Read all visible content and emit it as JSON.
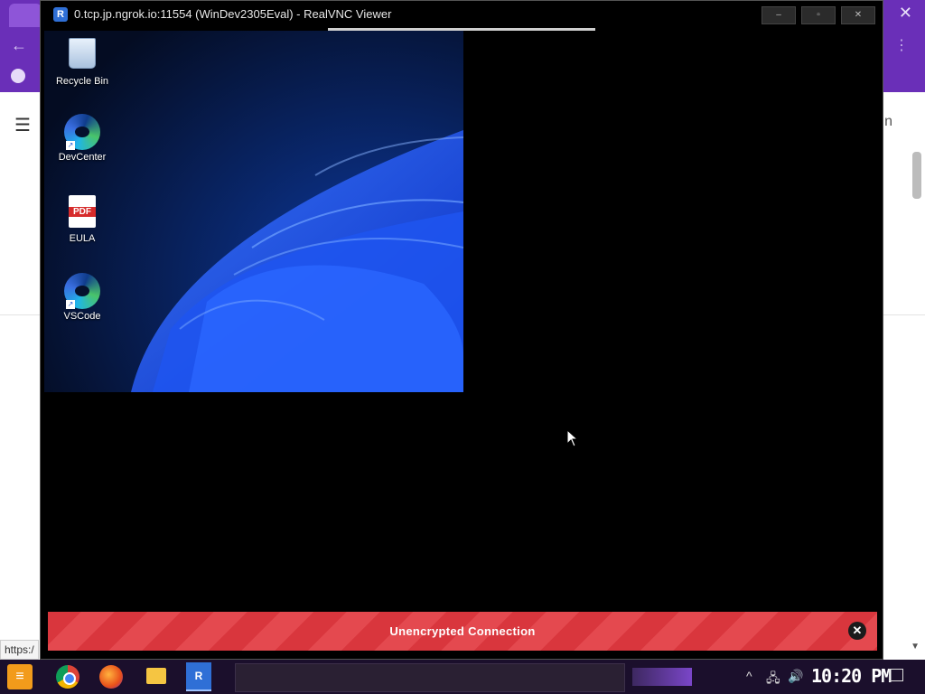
{
  "background": {
    "status_url": "https:/"
  },
  "vnc": {
    "title": "0.tcp.jp.ngrok.io:11554 (WinDev2305Eval) - RealVNC Viewer",
    "app_icon_glyph": "R",
    "controls": {
      "minimize": "–",
      "maximize": "▫",
      "close": "✕"
    },
    "desktop_icons": [
      {
        "label": "Recycle Bin",
        "icon": "recycle-bin-icon"
      },
      {
        "label": "DevCenter",
        "icon": "edge-icon"
      },
      {
        "label": "EULA",
        "icon": "pdf-icon",
        "badge": "PDF"
      },
      {
        "label": "VSCode",
        "icon": "edge-icon"
      }
    ],
    "banner": {
      "text": "Unencrypted Connection",
      "close_glyph": "✕"
    }
  },
  "taskbar": {
    "clock": "10:20 PM",
    "apps": [
      "chrome-icon",
      "firefox-icon",
      "file-explorer-icon",
      "realvnc-icon"
    ]
  },
  "colors": {
    "banner_red": "#d9363d",
    "browser_purple": "#6a2fb8",
    "taskbar": "#1b0f2c"
  }
}
